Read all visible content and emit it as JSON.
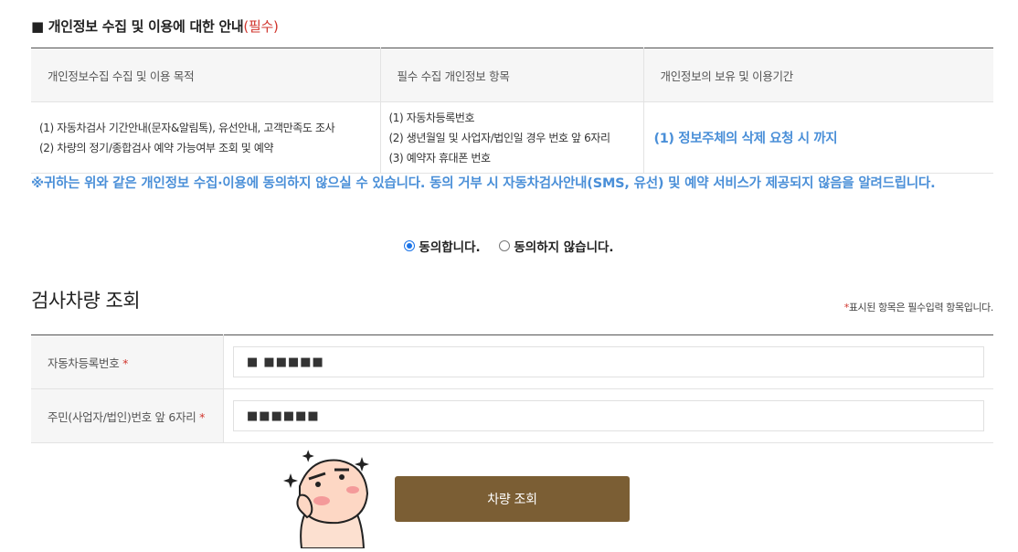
{
  "notice": {
    "title": "■ 개인정보 수집 및 이용에 대한 안내",
    "required_tag": "(필수)"
  },
  "privacy_table": {
    "headers": [
      "개인정보수집 수집 및 이용 목적",
      "필수 수집 개인정보 항목",
      "개인정보의 보유 및 이용기간"
    ],
    "purposes": [
      "(1) 자동차검사 기간안내(문자&알림톡), 유선안내, 고객만족도 조사",
      "(2) 차량의 정기/종합검사 예약 가능여부 조회 및 예약"
    ],
    "items": [
      "(1) 자동차등록번호",
      "(2) 생년월일 및 사업자/법인일 경우 번호 앞 6자리",
      "(3) 예약자 휴대폰 번호"
    ],
    "retention": "(1) 정보주체의 삭제 요청 시 까지"
  },
  "warning": "※귀하는 위와 같은 개인정보 수집·이용에 동의하지 않으실 수 있습니다. 동의 거부 시 자동차검사안내(SMS, 유선) 및 예약 서비스가 제공되지 않음을 알려드립니다.",
  "consent": {
    "agree": "동의합니다.",
    "disagree": "동의하지 않습니다.",
    "selected": "agree"
  },
  "search_section": {
    "title": "검사차량 조회",
    "required_note_star": "*",
    "required_note": "표시된 항목은 필수입력 항목입니다.",
    "fields": [
      {
        "label": "자동차등록번호",
        "star": "*",
        "value": "■ ■■■■■"
      },
      {
        "label": "주민(사업자/법인)번호 앞 6자리",
        "star": "*",
        "value": "■■■■■■"
      }
    ],
    "button": "차량 조회"
  },
  "colors": {
    "accent_blue": "#4a8fd8",
    "required_red": "#d0342c",
    "button_brown": "#7b5e34"
  },
  "icons": {
    "mascot": "thinking-peach-character"
  }
}
